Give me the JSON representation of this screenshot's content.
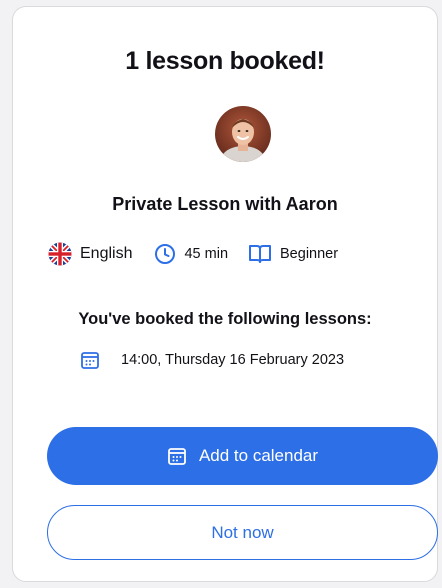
{
  "modal": {
    "title": "1 lesson booked!",
    "lesson_title": "Private Lesson with Aaron",
    "language": "English",
    "duration": "45 min",
    "level": "Beginner",
    "booked_heading": "You've booked the following lessons:",
    "bookings": [
      {
        "datetime": "14:00, Thursday 16 February 2023"
      }
    ],
    "add_to_calendar_label": "Add to calendar",
    "not_now_label": "Not now"
  },
  "colors": {
    "accent": "#2d6fe6",
    "text": "#121117"
  },
  "icons": {
    "language": "uk-flag-icon",
    "duration": "clock-icon",
    "level": "book-icon",
    "booking": "calendar-icon",
    "button": "calendar-icon"
  }
}
